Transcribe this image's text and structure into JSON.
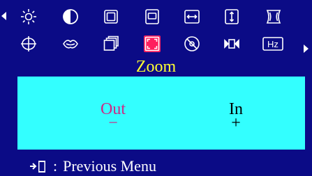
{
  "osd": {
    "background_color": "#0b0b86",
    "panel_color": "#33ffff",
    "highlight_color": "#ff1f5e",
    "title_color": "#ffff33",
    "menu_title": "Zoom",
    "options": [
      {
        "label": "Out",
        "sign": "−"
      },
      {
        "label": "In",
        "sign": "+"
      }
    ],
    "selected_option": "Out",
    "footer": {
      "separator": ":",
      "text": "Previous Menu"
    },
    "icons_row1": [
      "brightness-icon",
      "contrast-icon",
      "h-position-icon",
      "v-position-icon",
      "h-size-icon",
      "v-size-icon",
      "pincushion-icon"
    ],
    "icons_row2": [
      "rotation-icon",
      "color-icon",
      "recall-icon",
      "zoom-icon",
      "degauss-icon",
      "moire-icon",
      "frequency-icon"
    ],
    "selected_icon": "zoom-icon",
    "frequency_label": "Hz"
  }
}
